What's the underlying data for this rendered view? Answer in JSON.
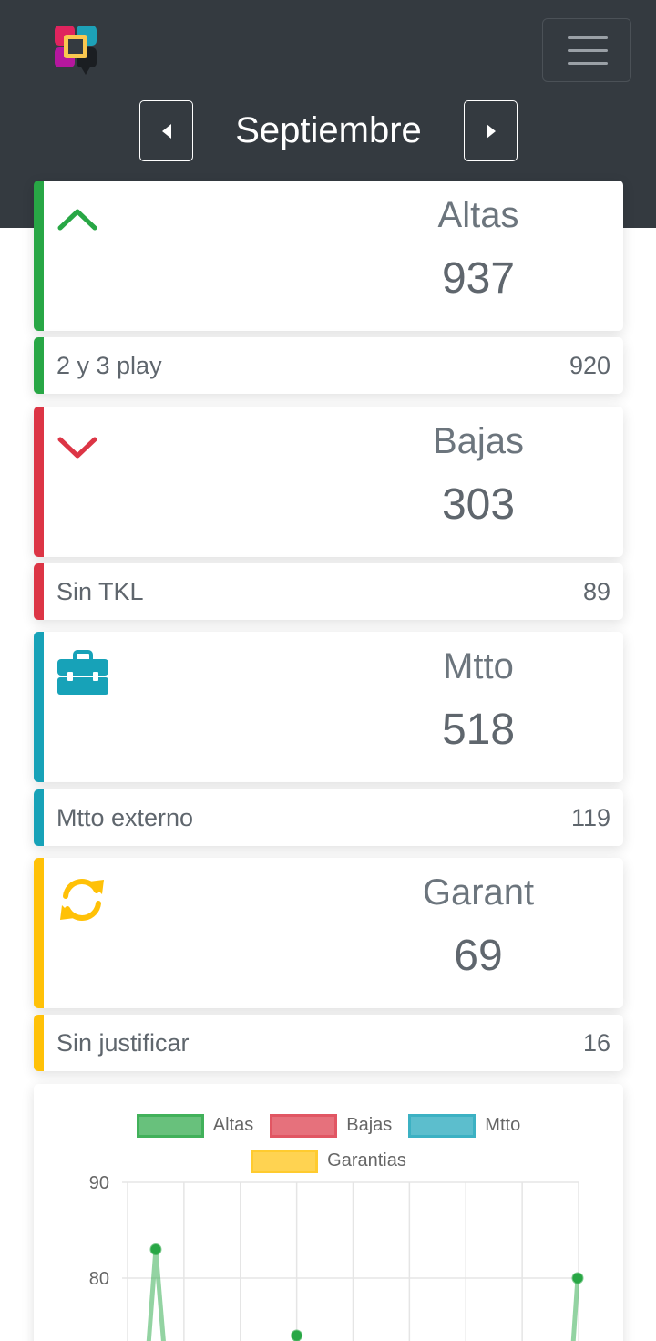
{
  "header": {
    "logo": "app-logo",
    "month": "Septiembre",
    "prev_icon": "caret-left-icon",
    "next_icon": "caret-right-icon",
    "menu_icon": "hamburger-icon"
  },
  "colors": {
    "header_bg": "#343a40",
    "altas": "#28a745",
    "bajas": "#dc3545",
    "mtto": "#17a2b8",
    "garant": "#ffc107"
  },
  "cards": [
    {
      "title": "Altas",
      "value": "937",
      "icon": "chevron-up-icon",
      "sub_label": "2 y 3 play",
      "sub_value": "920"
    },
    {
      "title": "Bajas",
      "value": "303",
      "icon": "chevron-down-icon",
      "sub_label": "Sin TKL",
      "sub_value": "89"
    },
    {
      "title": "Mtto",
      "value": "518",
      "icon": "toolbox-icon",
      "sub_label": "Mtto externo",
      "sub_value": "119"
    },
    {
      "title": "Garant",
      "value": "69",
      "icon": "sync-icon",
      "sub_label": "Sin justificar",
      "sub_value": "16"
    }
  ],
  "chart_data": {
    "type": "line",
    "legend": [
      "Altas",
      "Bajas",
      "Mtto",
      "Garantias"
    ],
    "legend_position": "top",
    "y_ticks_visible": [
      90,
      80
    ],
    "ylim_visible": [
      null,
      90
    ],
    "grid": true,
    "series": [
      {
        "name": "Altas",
        "color": "#28a745",
        "points_visible": [
          {
            "index": 1,
            "y": 83
          },
          {
            "index": 4,
            "y": 74
          },
          {
            "index": 8,
            "y": 80
          }
        ]
      }
    ]
  }
}
